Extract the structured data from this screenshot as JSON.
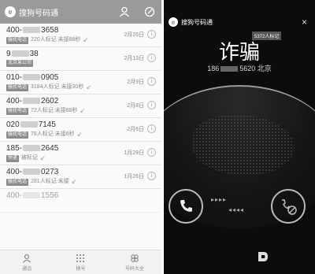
{
  "left_app": {
    "header": {
      "brand_letter": "e",
      "title": "搜狗号码通"
    },
    "calls": [
      {
        "number_prefix": "400-",
        "number_suffix": "3658",
        "tag": "骚扰电话",
        "note": "220人标记 未接88秒",
        "date": "2月26日"
      },
      {
        "number_prefix": "9",
        "number_suffix": "38",
        "tag": "北京某公司",
        "note": "",
        "date": "2月13日"
      },
      {
        "number_prefix": "010-",
        "number_suffix": "0905",
        "tag": "骚扰电话",
        "note": "3184人标记 未接30秒",
        "date": "2月9日"
      },
      {
        "number_prefix": "400-",
        "number_suffix": "2602",
        "tag": "骚扰电话",
        "note": "72人标记 未接88秒",
        "date": "2月8日"
      },
      {
        "number_prefix": "020",
        "number_suffix": "7145",
        "tag": "骚扰电话",
        "note": "78人标记 未接6秒",
        "date": "2月6日"
      },
      {
        "number_prefix": "185-",
        "number_suffix": "2645",
        "tag": "快递",
        "note": "被标记",
        "date": "1月29日"
      },
      {
        "number_prefix": "400-",
        "number_suffix": "0273",
        "tag": "骚扰电话",
        "note": "281人标记 未接",
        "date": "1月26日"
      },
      {
        "number_prefix": "400-",
        "number_suffix": "1556",
        "tag": "",
        "note": "",
        "date": ""
      }
    ],
    "tabs": [
      {
        "label": "通话",
        "icon": "person-icon"
      },
      {
        "label": "拨号",
        "icon": "dialpad-icon"
      },
      {
        "label": "号码大全",
        "icon": "clover-icon"
      }
    ]
  },
  "right_app": {
    "title": "搜狗号码通",
    "close": "×",
    "marked_badge": "5372人标记",
    "label": "诈骗",
    "number_prefix": "186",
    "number_suffix": "5620",
    "location": "北京",
    "colors": {
      "background": "#0c0c0c",
      "ring": "#bbbbbb"
    }
  }
}
